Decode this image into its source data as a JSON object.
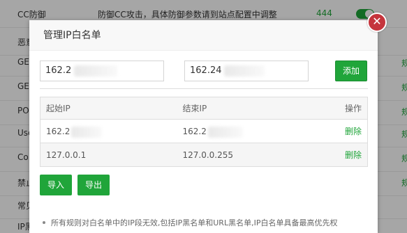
{
  "background": {
    "rows": [
      {
        "name": "CC防御",
        "desc": "防御CC攻击，具体防御参数请到站点配置中调整",
        "count": "444",
        "link": ""
      },
      {
        "name": "恶意",
        "desc": "",
        "count": "",
        "link": ""
      },
      {
        "name": "GE",
        "desc": "",
        "count": "",
        "link": "规"
      },
      {
        "name": "GE",
        "desc": "",
        "count": "",
        "link": "规"
      },
      {
        "name": "PO",
        "desc": "",
        "count": "",
        "link": "规"
      },
      {
        "name": "Use",
        "desc": "",
        "count": "",
        "link": "规"
      },
      {
        "name": "Co",
        "desc": "",
        "count": "",
        "link": "规"
      },
      {
        "name": "禁止",
        "desc": "",
        "count": "",
        "link": "规"
      },
      {
        "name": "常见",
        "desc": "",
        "count": "",
        "link": ""
      },
      {
        "name": "IP黑",
        "desc": "",
        "count": "",
        "link": ""
      }
    ]
  },
  "dialog": {
    "title": "管理IP白名单",
    "close_icon": "close-icon",
    "start_input_value": "162.2",
    "end_input_value": "162.24",
    "add_label": "添加",
    "table": {
      "headers": [
        "起始IP",
        "结束IP",
        "操作"
      ],
      "rows": [
        {
          "start": "162.2",
          "end": "162.2",
          "action": "删除"
        },
        {
          "start": "127.0.0.1",
          "end": "127.0.0.255",
          "action": "删除"
        }
      ]
    },
    "import_label": "导入",
    "export_label": "导出",
    "note": "所有规则对白名单中的IP段无效,包括IP黑名单和URL黑名单,IP白名单具备最高优先权"
  },
  "colors": {
    "accent": "#20a53a",
    "close": "#c5343c"
  }
}
